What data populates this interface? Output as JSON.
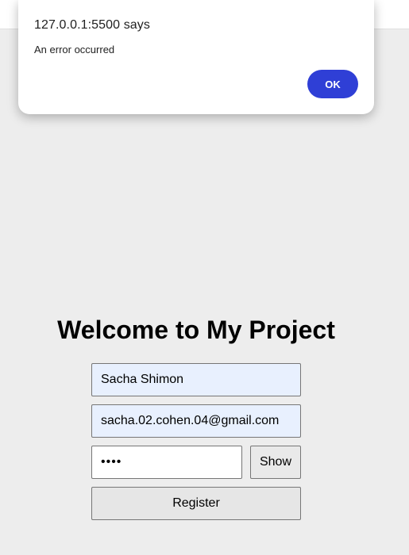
{
  "alert": {
    "title": "127.0.0.1:5500 says",
    "message": "An error occurred",
    "ok_label": "OK"
  },
  "page": {
    "title": "Welcome to My Project"
  },
  "form": {
    "name_value": "Sacha Shimon",
    "email_value": "sacha.02.cohen.04@gmail.com",
    "password_value": "1234",
    "show_label": "Show",
    "register_label": "Register"
  },
  "colors": {
    "accent": "#2f3fd6",
    "autofill": "#e8f0fe",
    "background": "#ededed"
  }
}
